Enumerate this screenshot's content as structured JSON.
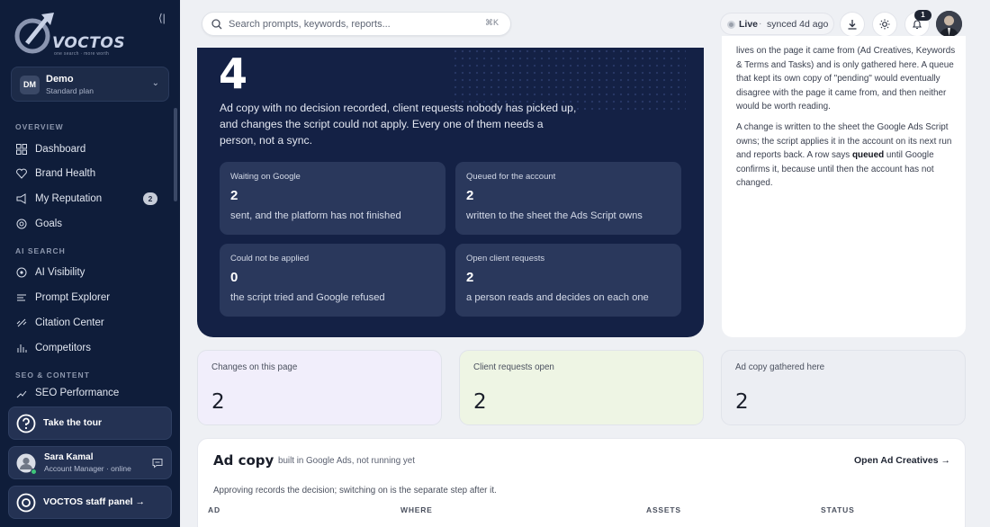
{
  "sidebar": {
    "brand": {
      "name": "VOCTOS",
      "tagline": "one search · more worth"
    },
    "workspace": {
      "initials": "DM",
      "name": "Demo",
      "plan": "Standard plan"
    },
    "sections": [
      {
        "title": "OVERVIEW",
        "items": [
          {
            "label": "Dashboard",
            "icon": "grid-icon"
          },
          {
            "label": "Brand Health",
            "icon": "heart-icon"
          },
          {
            "label": "My Reputation",
            "icon": "megaphone-icon",
            "badge": "2"
          },
          {
            "label": "Goals",
            "icon": "target-icon"
          }
        ]
      },
      {
        "title": "AI SEARCH",
        "items": [
          {
            "label": "AI Visibility",
            "icon": "eye-circle-icon"
          },
          {
            "label": "Prompt Explorer",
            "icon": "lines-icon"
          },
          {
            "label": "Citation Center",
            "icon": "link-icon"
          },
          {
            "label": "Competitors",
            "icon": "bar-chart-icon"
          }
        ]
      },
      {
        "title": "SEO & CONTENT",
        "items": [
          {
            "label": "SEO Performance",
            "icon": "trend-icon"
          }
        ]
      }
    ],
    "tour": {
      "label": "Take the tour"
    },
    "user": {
      "name": "Sara Kamal",
      "role": "Account Manager · online"
    },
    "staff": {
      "label": "VOCTOS staff panel →"
    }
  },
  "topbar": {
    "search_placeholder": "Search prompts, keywords, reports...",
    "shortcut": "⌘K",
    "live_label": "Live",
    "separator": "·",
    "synced": "synced 4d ago",
    "notification_count": "1"
  },
  "hero": {
    "count": "4",
    "description": "Ad copy with no decision recorded, client requests nobody has picked up, and changes the script could not apply. Every one of them needs a person, not a sync.",
    "stats": [
      {
        "label": "Waiting on Google",
        "value": "2",
        "sub": "sent, and the platform has not finished"
      },
      {
        "label": "Queued for the account",
        "value": "2",
        "sub": "written to the sheet the Ads Script owns"
      },
      {
        "label": "Could not be applied",
        "value": "0",
        "sub": "the script tried and Google refused"
      },
      {
        "label": "Open client requests",
        "value": "2",
        "sub": "a person reads and decides on each one"
      }
    ]
  },
  "info_panel": {
    "para1": "lives on the page it came from (Ad Creatives, Keywords & Terms and Tasks) and is only gathered here. A queue that kept its own copy of \"pending\" would eventually disagree with the page it came from, and then neither would be worth reading.",
    "para2_before": "A change is written to the sheet the Google Ads Script owns; the script applies it in the account on its next run and reports back. A row says ",
    "para2_bold": "queued",
    "para2_after": " until Google confirms it, because until then the account has not changed."
  },
  "metrics": [
    {
      "label": "Changes on this page",
      "value": "2",
      "bg": "#f1eefb"
    },
    {
      "label": "Client requests open",
      "value": "2",
      "bg": "#eef5e4"
    },
    {
      "label": "Ad copy gathered here",
      "value": "2",
      "bg": "#eceef3"
    }
  ],
  "ad_copy": {
    "title": "Ad copy",
    "subtitle": "built in Google Ads, not running yet",
    "link": "Open Ad Creatives →",
    "note": "Approving records the decision; switching on is the separate step after it.",
    "columns": [
      "AD",
      "WHERE",
      "ASSETS",
      "STATUS"
    ]
  },
  "colors": {
    "sidebar_bg": "#0f1d3a",
    "hero_bg": "#142145",
    "stat_bg": "#2a385c"
  }
}
